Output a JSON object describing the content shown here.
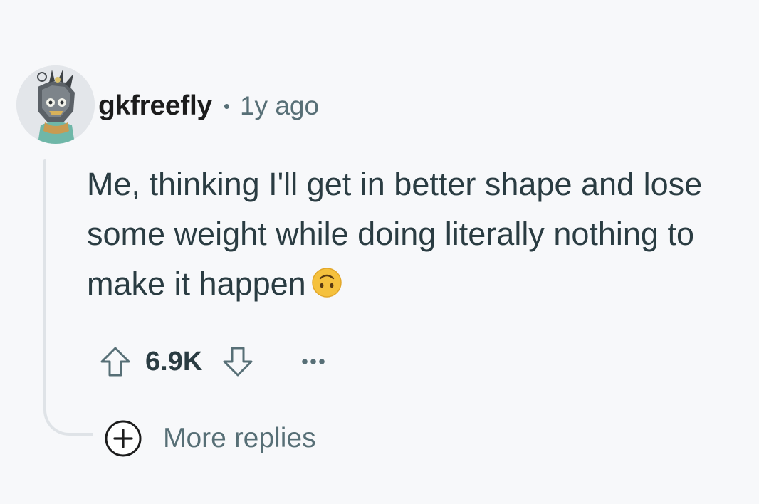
{
  "comment": {
    "author": "gkfreefly",
    "separator": "•",
    "time_ago": "1y ago",
    "body": "Me, thinking I'll get in better shape and lose some weight while doing literally nothing to make it happen",
    "emoji": "upside-down-face-emoji",
    "score": "6.9K"
  },
  "actions": {
    "upvote_icon": "arrow-up-outline-icon",
    "downvote_icon": "arrow-down-outline-icon",
    "more_icon": "ellipsis-icon"
  },
  "replies": {
    "icon": "plus-circle-icon",
    "label": "More replies"
  },
  "colors": {
    "background": "#f7f8fa",
    "username": "#1c1c1c",
    "meta_text": "#576f76",
    "body_text": "#2a3c42",
    "thread_line": "#dfe3e7",
    "emoji_face": "#f5c13d"
  }
}
